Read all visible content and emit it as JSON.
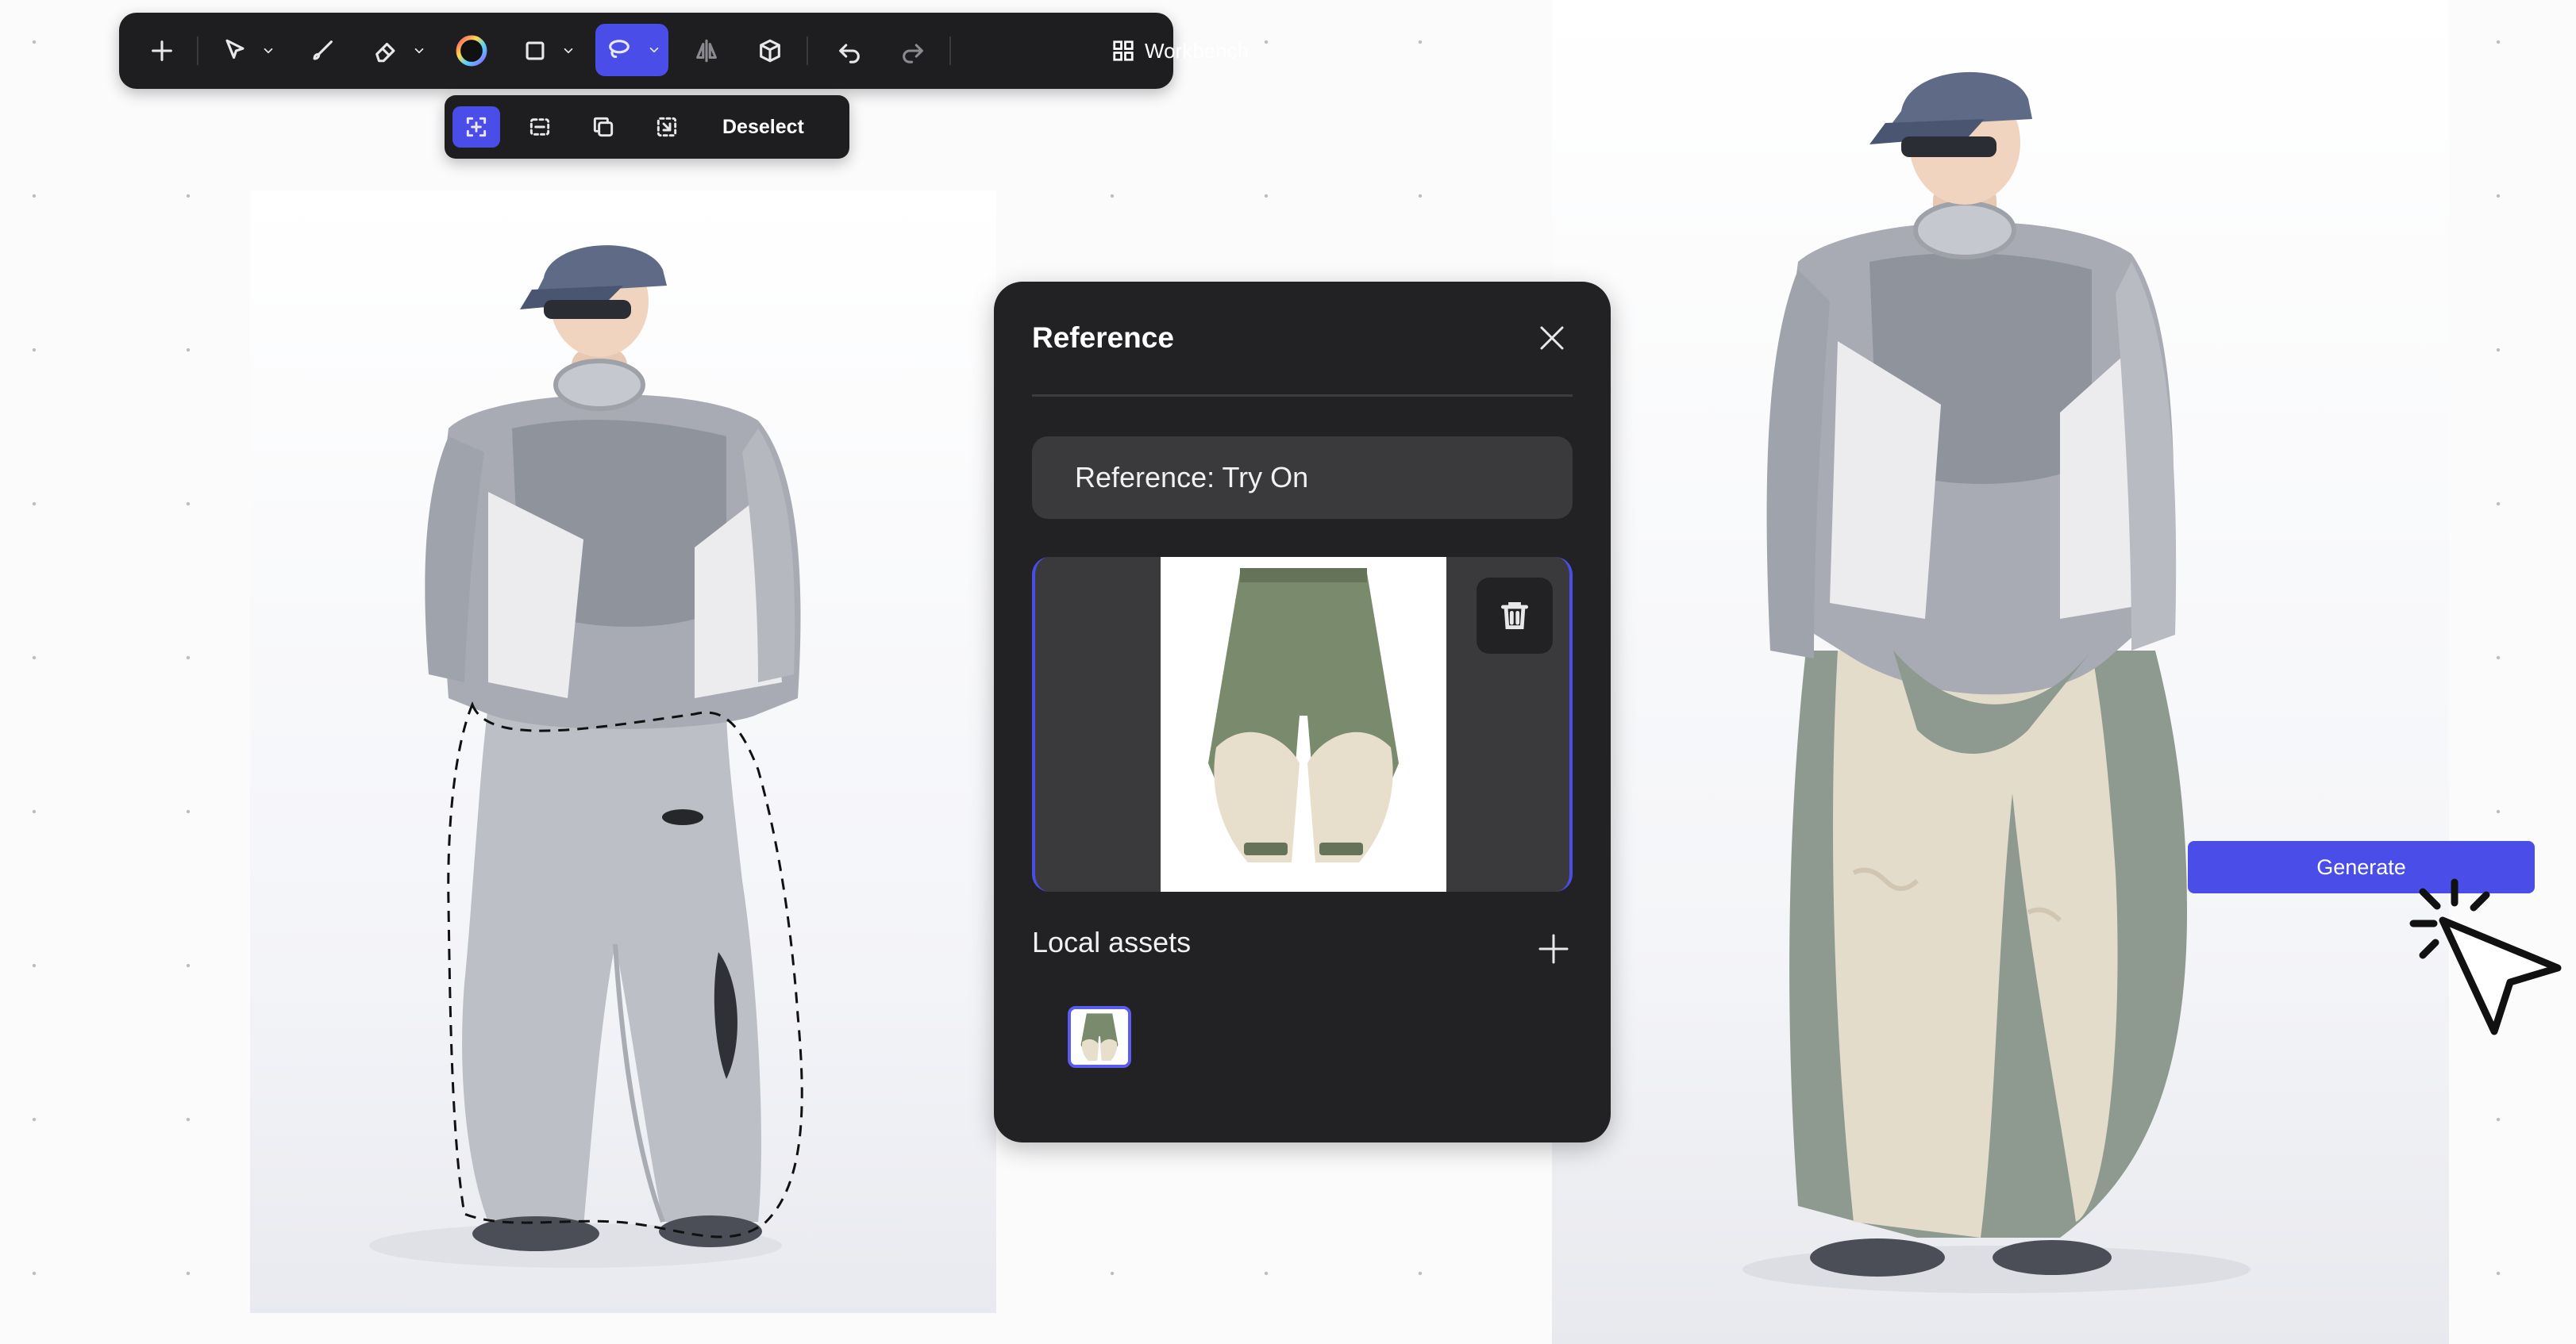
{
  "toolbar": {
    "tools": [
      {
        "name": "add-icon"
      },
      {
        "name": "select-arrow-icon"
      },
      {
        "name": "brush-icon"
      },
      {
        "name": "eraser-icon"
      },
      {
        "name": "color-wheel-icon"
      },
      {
        "name": "rectangle-icon"
      },
      {
        "name": "lasso-icon",
        "active": true
      },
      {
        "name": "flip-icon"
      },
      {
        "name": "3d-box-icon"
      },
      {
        "name": "undo-icon"
      },
      {
        "name": "redo-icon",
        "disabled": true
      }
    ],
    "workbench_label": "Workbench"
  },
  "selection_bar": {
    "tools": [
      "select-all-icon",
      "marquee-icon",
      "copy-icon",
      "invert-selection-icon"
    ],
    "deselect_label": "Deselect"
  },
  "reference_panel": {
    "title": "Reference",
    "reference_value": "Reference: Try On",
    "local_assets_title": "Local assets"
  },
  "generate_label": "Generate",
  "colors": {
    "accent": "#4b4de8",
    "panel_bg": "#222224",
    "toolbar_bg": "#1e1e20",
    "field_bg": "#3a3a3d"
  }
}
